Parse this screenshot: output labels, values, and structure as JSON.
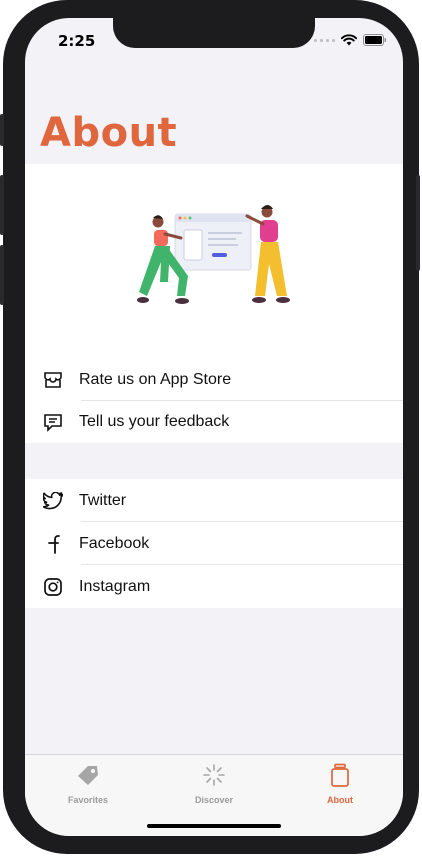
{
  "status_bar": {
    "time": "2:25"
  },
  "page": {
    "title": "About"
  },
  "app_store_section": {
    "items": [
      {
        "icon": "storefront-icon",
        "label": "Rate us on App Store"
      },
      {
        "icon": "message-icon",
        "label": "Tell us your feedback"
      }
    ]
  },
  "social_section": {
    "items": [
      {
        "icon": "twitter-icon",
        "label": "Twitter"
      },
      {
        "icon": "facebook-icon",
        "label": "Facebook"
      },
      {
        "icon": "instagram-icon",
        "label": "Instagram"
      }
    ]
  },
  "tab_bar": {
    "tabs": [
      {
        "icon": "tag-icon",
        "label": "Favorites",
        "selected": false
      },
      {
        "icon": "sparkle-icon",
        "label": "Discover",
        "selected": false
      },
      {
        "icon": "jar-icon",
        "label": "About",
        "selected": true
      }
    ]
  },
  "colors": {
    "accent": "#e0663e",
    "tab_inactive": "#9b9b9b",
    "background": "#f2f2f7"
  }
}
